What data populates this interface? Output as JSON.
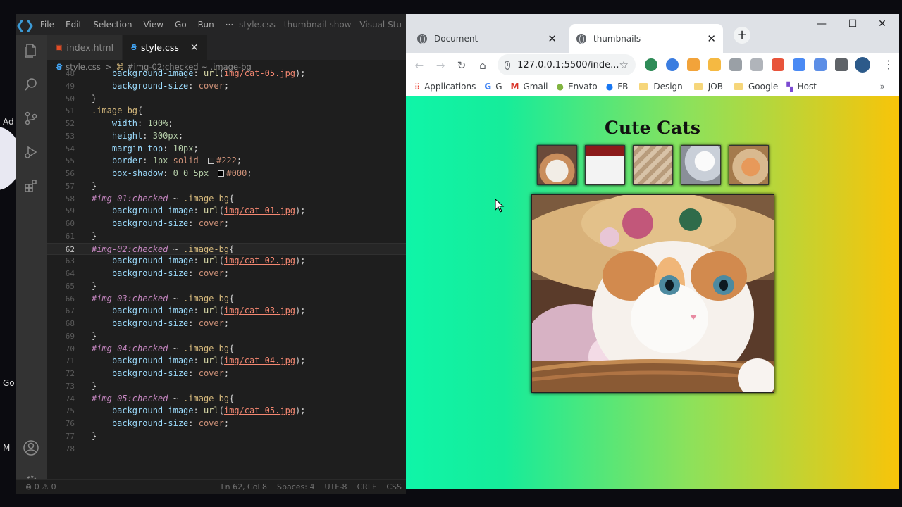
{
  "desktop": {
    "fragments": [
      "Ad",
      "Go",
      "M"
    ]
  },
  "vscode": {
    "menu": [
      "File",
      "Edit",
      "Selection",
      "View",
      "Go",
      "Run",
      "···"
    ],
    "window_title": "style.css - thumbnail show - Visual Stu",
    "tabs": [
      {
        "label": "index.html",
        "icon": "html-file-icon",
        "active": false
      },
      {
        "label": "style.css",
        "icon": "css-file-icon",
        "active": true
      }
    ],
    "breadcrumb": {
      "file": "style.css",
      "separator": ">",
      "symbol": "#img-02:checked ~ .image-bg"
    },
    "current_line": 62,
    "status": {
      "problems": "⊗ 0 ⚠ 0",
      "position": "Ln 62, Col 8",
      "spaces": "Spaces: 4",
      "encoding": "UTF-8",
      "eol": "CRLF",
      "language": "CSS"
    }
  },
  "code_lines": [
    {
      "n": "48",
      "t": [
        [
          "prop",
          "    background-image"
        ],
        [
          "punc",
          ": "
        ],
        [
          "fn",
          "url"
        ],
        [
          "punc",
          "("
        ],
        [
          "url",
          "img/cat-05.jpg"
        ],
        [
          "punc",
          ");"
        ]
      ]
    },
    {
      "n": "49",
      "t": [
        [
          "prop",
          "    background-size"
        ],
        [
          "punc",
          ": "
        ],
        [
          "val",
          "cover"
        ],
        [
          "punc",
          ";"
        ]
      ]
    },
    {
      "n": "50",
      "t": [
        [
          "punc",
          "}"
        ]
      ]
    },
    {
      "n": "51",
      "t": [
        [
          "sel",
          ".image-bg"
        ],
        [
          "punc",
          "{"
        ]
      ]
    },
    {
      "n": "52",
      "t": [
        [
          "prop",
          "    width"
        ],
        [
          "punc",
          ": "
        ],
        [
          "num",
          "100%"
        ],
        [
          "punc",
          ";"
        ]
      ]
    },
    {
      "n": "53",
      "t": [
        [
          "prop",
          "    height"
        ],
        [
          "punc",
          ": "
        ],
        [
          "num",
          "300px"
        ],
        [
          "punc",
          ";"
        ]
      ]
    },
    {
      "n": "54",
      "t": [
        [
          "prop",
          "    margin-top"
        ],
        [
          "punc",
          ": "
        ],
        [
          "num",
          "10px"
        ],
        [
          "punc",
          ";"
        ]
      ]
    },
    {
      "n": "55",
      "t": [
        [
          "prop",
          "    border"
        ],
        [
          "punc",
          ": "
        ],
        [
          "num",
          "1px"
        ],
        [
          "val",
          " solid "
        ],
        [
          "swatch",
          "#222"
        ],
        [
          "val",
          "#222"
        ],
        [
          "punc",
          ";"
        ]
      ]
    },
    {
      "n": "56",
      "t": [
        [
          "prop",
          "    box-shadow"
        ],
        [
          "punc",
          ": "
        ],
        [
          "num",
          "0 0 5px "
        ],
        [
          "swatch",
          "#000"
        ],
        [
          "val",
          "#000"
        ],
        [
          "punc",
          ";"
        ]
      ]
    },
    {
      "n": "57",
      "t": [
        [
          "punc",
          "}"
        ]
      ]
    },
    {
      "n": "58",
      "t": [
        [
          "selit",
          "#img-01:checked"
        ],
        [
          "punc",
          " ~ "
        ],
        [
          "sel",
          ".image-bg"
        ],
        [
          "punc",
          "{"
        ]
      ]
    },
    {
      "n": "59",
      "t": [
        [
          "prop",
          "    background-image"
        ],
        [
          "punc",
          ": "
        ],
        [
          "fn",
          "url"
        ],
        [
          "punc",
          "("
        ],
        [
          "url",
          "img/cat-01.jpg"
        ],
        [
          "punc",
          ");"
        ]
      ]
    },
    {
      "n": "60",
      "t": [
        [
          "prop",
          "    background-size"
        ],
        [
          "punc",
          ": "
        ],
        [
          "val",
          "cover"
        ],
        [
          "punc",
          ";"
        ]
      ]
    },
    {
      "n": "61",
      "t": [
        [
          "punc",
          "}"
        ]
      ]
    },
    {
      "n": "62",
      "t": [
        [
          "selit",
          "#img-02:checked"
        ],
        [
          "punc",
          " ~ "
        ],
        [
          "sel",
          ".image-bg"
        ],
        [
          "punc",
          "{"
        ]
      ]
    },
    {
      "n": "63",
      "t": [
        [
          "prop",
          "    background-image"
        ],
        [
          "punc",
          ": "
        ],
        [
          "fn",
          "url"
        ],
        [
          "punc",
          "("
        ],
        [
          "url",
          "img/cat-02.jpg"
        ],
        [
          "punc",
          ");"
        ]
      ]
    },
    {
      "n": "64",
      "t": [
        [
          "prop",
          "    background-size"
        ],
        [
          "punc",
          ": "
        ],
        [
          "val",
          "cover"
        ],
        [
          "punc",
          ";"
        ]
      ]
    },
    {
      "n": "65",
      "t": [
        [
          "punc",
          "}"
        ]
      ]
    },
    {
      "n": "66",
      "t": [
        [
          "selit",
          "#img-03:checked"
        ],
        [
          "punc",
          " ~ "
        ],
        [
          "sel",
          ".image-bg"
        ],
        [
          "punc",
          "{"
        ]
      ]
    },
    {
      "n": "67",
      "t": [
        [
          "prop",
          "    background-image"
        ],
        [
          "punc",
          ": "
        ],
        [
          "fn",
          "url"
        ],
        [
          "punc",
          "("
        ],
        [
          "url",
          "img/cat-03.jpg"
        ],
        [
          "punc",
          ");"
        ]
      ]
    },
    {
      "n": "68",
      "t": [
        [
          "prop",
          "    background-size"
        ],
        [
          "punc",
          ": "
        ],
        [
          "val",
          "cover"
        ],
        [
          "punc",
          ";"
        ]
      ]
    },
    {
      "n": "69",
      "t": [
        [
          "punc",
          "}"
        ]
      ]
    },
    {
      "n": "70",
      "t": [
        [
          "selit",
          "#img-04:checked"
        ],
        [
          "punc",
          " ~ "
        ],
        [
          "sel",
          ".image-bg"
        ],
        [
          "punc",
          "{"
        ]
      ]
    },
    {
      "n": "71",
      "t": [
        [
          "prop",
          "    background-image"
        ],
        [
          "punc",
          ": "
        ],
        [
          "fn",
          "url"
        ],
        [
          "punc",
          "("
        ],
        [
          "url",
          "img/cat-04.jpg"
        ],
        [
          "punc",
          ");"
        ]
      ]
    },
    {
      "n": "72",
      "t": [
        [
          "prop",
          "    background-size"
        ],
        [
          "punc",
          ": "
        ],
        [
          "val",
          "cover"
        ],
        [
          "punc",
          ";"
        ]
      ]
    },
    {
      "n": "73",
      "t": [
        [
          "punc",
          "}"
        ]
      ]
    },
    {
      "n": "74",
      "t": [
        [
          "selit",
          "#img-05:checked"
        ],
        [
          "punc",
          " ~ "
        ],
        [
          "sel",
          ".image-bg"
        ],
        [
          "punc",
          "{"
        ]
      ]
    },
    {
      "n": "75",
      "t": [
        [
          "prop",
          "    background-image"
        ],
        [
          "punc",
          ": "
        ],
        [
          "fn",
          "url"
        ],
        [
          "punc",
          "("
        ],
        [
          "url",
          "img/cat-05.jpg"
        ],
        [
          "punc",
          ");"
        ]
      ]
    },
    {
      "n": "76",
      "t": [
        [
          "prop",
          "    background-size"
        ],
        [
          "punc",
          ": "
        ],
        [
          "val",
          "cover"
        ],
        [
          "punc",
          ";"
        ]
      ]
    },
    {
      "n": "77",
      "t": [
        [
          "punc",
          "}"
        ]
      ]
    },
    {
      "n": "78",
      "t": []
    }
  ],
  "browser": {
    "tabs": [
      {
        "label": "Document",
        "active": false
      },
      {
        "label": "thumbnails",
        "active": true
      }
    ],
    "address": "127.0.0.1:5500/inde...",
    "bookmarks": [
      {
        "label": "Applications",
        "icon": "apps-grid-icon"
      },
      {
        "label": "G",
        "icon": "google-icon"
      },
      {
        "label": "Gmail",
        "icon": "gmail-icon"
      },
      {
        "label": "Envato",
        "icon": "envato-icon"
      },
      {
        "label": "FB",
        "icon": "facebook-icon"
      },
      {
        "label": "Design",
        "icon": "folder-icon"
      },
      {
        "label": "JOB",
        "icon": "folder-icon"
      },
      {
        "label": "Google",
        "icon": "folder-icon"
      },
      {
        "label": "Host",
        "icon": "host-icon"
      }
    ],
    "more": "»"
  },
  "page": {
    "title": "Cute Cats",
    "thumbnails": [
      "cat-thumbnail-1",
      "cat-thumbnail-2",
      "cat-thumbnail-3",
      "cat-thumbnail-4",
      "cat-thumbnail-5"
    ],
    "main_image": "kitten-in-straw-hat"
  },
  "colors": {
    "gradient_start": "#0ff5a8",
    "gradient_end": "#f8c409",
    "vscode_bg": "#1e1e1e",
    "selector": "#d7ba7d",
    "property": "#9cdcfe",
    "value": "#ce9178"
  }
}
